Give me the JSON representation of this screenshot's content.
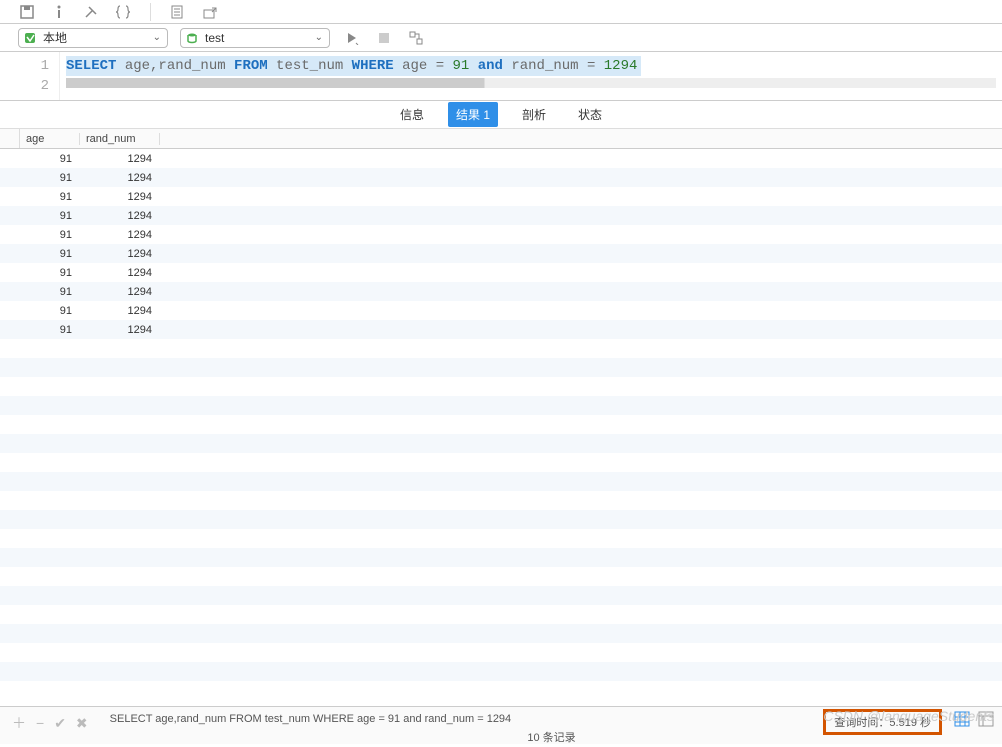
{
  "toolbar": {
    "connection_label": "本地",
    "database_label": "test"
  },
  "editor": {
    "lines": [
      "1",
      "2"
    ],
    "sql": {
      "kw_select": "SELECT",
      "cols": " age,rand_num ",
      "kw_from": "FROM",
      "table": " test_num ",
      "kw_where": "WHERE",
      "cond1_col": " age ",
      "eq1": "= ",
      "val1": "91",
      "sp1": " ",
      "kw_and": "and",
      "cond2_col": " rand_num ",
      "eq2": "= ",
      "val2": "1294"
    }
  },
  "tabs": {
    "info": "信息",
    "result": "结果 1",
    "profile": "剖析",
    "status": "状态"
  },
  "grid": {
    "headers": {
      "age": "age",
      "rand_num": "rand_num"
    },
    "rows": [
      {
        "age": "91",
        "rand_num": "1294"
      },
      {
        "age": "91",
        "rand_num": "1294"
      },
      {
        "age": "91",
        "rand_num": "1294"
      },
      {
        "age": "91",
        "rand_num": "1294"
      },
      {
        "age": "91",
        "rand_num": "1294"
      },
      {
        "age": "91",
        "rand_num": "1294"
      },
      {
        "age": "91",
        "rand_num": "1294"
      },
      {
        "age": "91",
        "rand_num": "1294"
      },
      {
        "age": "91",
        "rand_num": "1294"
      },
      {
        "age": "91",
        "rand_num": "1294"
      }
    ]
  },
  "status": {
    "query_text": "SELECT age,rand_num FROM test_num WHERE age = 91 and rand_num = 1294",
    "record_count": "10 条记录",
    "query_time": "查询时间：5.519 秒"
  },
  "watermark": "CSDN @languageStudents"
}
